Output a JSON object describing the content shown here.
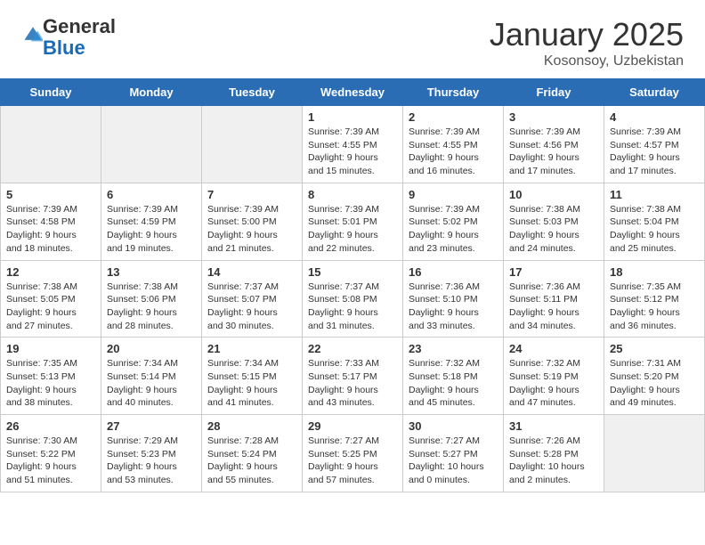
{
  "logo": {
    "general": "General",
    "blue": "Blue"
  },
  "header": {
    "month": "January 2025",
    "location": "Kosonsoy, Uzbekistan"
  },
  "weekdays": [
    "Sunday",
    "Monday",
    "Tuesday",
    "Wednesday",
    "Thursday",
    "Friday",
    "Saturday"
  ],
  "weeks": [
    [
      {
        "day": "",
        "info": ""
      },
      {
        "day": "",
        "info": ""
      },
      {
        "day": "",
        "info": ""
      },
      {
        "day": "1",
        "info": "Sunrise: 7:39 AM\nSunset: 4:55 PM\nDaylight: 9 hours\nand 15 minutes."
      },
      {
        "day": "2",
        "info": "Sunrise: 7:39 AM\nSunset: 4:55 PM\nDaylight: 9 hours\nand 16 minutes."
      },
      {
        "day": "3",
        "info": "Sunrise: 7:39 AM\nSunset: 4:56 PM\nDaylight: 9 hours\nand 17 minutes."
      },
      {
        "day": "4",
        "info": "Sunrise: 7:39 AM\nSunset: 4:57 PM\nDaylight: 9 hours\nand 17 minutes."
      }
    ],
    [
      {
        "day": "5",
        "info": "Sunrise: 7:39 AM\nSunset: 4:58 PM\nDaylight: 9 hours\nand 18 minutes."
      },
      {
        "day": "6",
        "info": "Sunrise: 7:39 AM\nSunset: 4:59 PM\nDaylight: 9 hours\nand 19 minutes."
      },
      {
        "day": "7",
        "info": "Sunrise: 7:39 AM\nSunset: 5:00 PM\nDaylight: 9 hours\nand 21 minutes."
      },
      {
        "day": "8",
        "info": "Sunrise: 7:39 AM\nSunset: 5:01 PM\nDaylight: 9 hours\nand 22 minutes."
      },
      {
        "day": "9",
        "info": "Sunrise: 7:39 AM\nSunset: 5:02 PM\nDaylight: 9 hours\nand 23 minutes."
      },
      {
        "day": "10",
        "info": "Sunrise: 7:38 AM\nSunset: 5:03 PM\nDaylight: 9 hours\nand 24 minutes."
      },
      {
        "day": "11",
        "info": "Sunrise: 7:38 AM\nSunset: 5:04 PM\nDaylight: 9 hours\nand 25 minutes."
      }
    ],
    [
      {
        "day": "12",
        "info": "Sunrise: 7:38 AM\nSunset: 5:05 PM\nDaylight: 9 hours\nand 27 minutes."
      },
      {
        "day": "13",
        "info": "Sunrise: 7:38 AM\nSunset: 5:06 PM\nDaylight: 9 hours\nand 28 minutes."
      },
      {
        "day": "14",
        "info": "Sunrise: 7:37 AM\nSunset: 5:07 PM\nDaylight: 9 hours\nand 30 minutes."
      },
      {
        "day": "15",
        "info": "Sunrise: 7:37 AM\nSunset: 5:08 PM\nDaylight: 9 hours\nand 31 minutes."
      },
      {
        "day": "16",
        "info": "Sunrise: 7:36 AM\nSunset: 5:10 PM\nDaylight: 9 hours\nand 33 minutes."
      },
      {
        "day": "17",
        "info": "Sunrise: 7:36 AM\nSunset: 5:11 PM\nDaylight: 9 hours\nand 34 minutes."
      },
      {
        "day": "18",
        "info": "Sunrise: 7:35 AM\nSunset: 5:12 PM\nDaylight: 9 hours\nand 36 minutes."
      }
    ],
    [
      {
        "day": "19",
        "info": "Sunrise: 7:35 AM\nSunset: 5:13 PM\nDaylight: 9 hours\nand 38 minutes."
      },
      {
        "day": "20",
        "info": "Sunrise: 7:34 AM\nSunset: 5:14 PM\nDaylight: 9 hours\nand 40 minutes."
      },
      {
        "day": "21",
        "info": "Sunrise: 7:34 AM\nSunset: 5:15 PM\nDaylight: 9 hours\nand 41 minutes."
      },
      {
        "day": "22",
        "info": "Sunrise: 7:33 AM\nSunset: 5:17 PM\nDaylight: 9 hours\nand 43 minutes."
      },
      {
        "day": "23",
        "info": "Sunrise: 7:32 AM\nSunset: 5:18 PM\nDaylight: 9 hours\nand 45 minutes."
      },
      {
        "day": "24",
        "info": "Sunrise: 7:32 AM\nSunset: 5:19 PM\nDaylight: 9 hours\nand 47 minutes."
      },
      {
        "day": "25",
        "info": "Sunrise: 7:31 AM\nSunset: 5:20 PM\nDaylight: 9 hours\nand 49 minutes."
      }
    ],
    [
      {
        "day": "26",
        "info": "Sunrise: 7:30 AM\nSunset: 5:22 PM\nDaylight: 9 hours\nand 51 minutes."
      },
      {
        "day": "27",
        "info": "Sunrise: 7:29 AM\nSunset: 5:23 PM\nDaylight: 9 hours\nand 53 minutes."
      },
      {
        "day": "28",
        "info": "Sunrise: 7:28 AM\nSunset: 5:24 PM\nDaylight: 9 hours\nand 55 minutes."
      },
      {
        "day": "29",
        "info": "Sunrise: 7:27 AM\nSunset: 5:25 PM\nDaylight: 9 hours\nand 57 minutes."
      },
      {
        "day": "30",
        "info": "Sunrise: 7:27 AM\nSunset: 5:27 PM\nDaylight: 10 hours\nand 0 minutes."
      },
      {
        "day": "31",
        "info": "Sunrise: 7:26 AM\nSunset: 5:28 PM\nDaylight: 10 hours\nand 2 minutes."
      },
      {
        "day": "",
        "info": ""
      }
    ]
  ]
}
